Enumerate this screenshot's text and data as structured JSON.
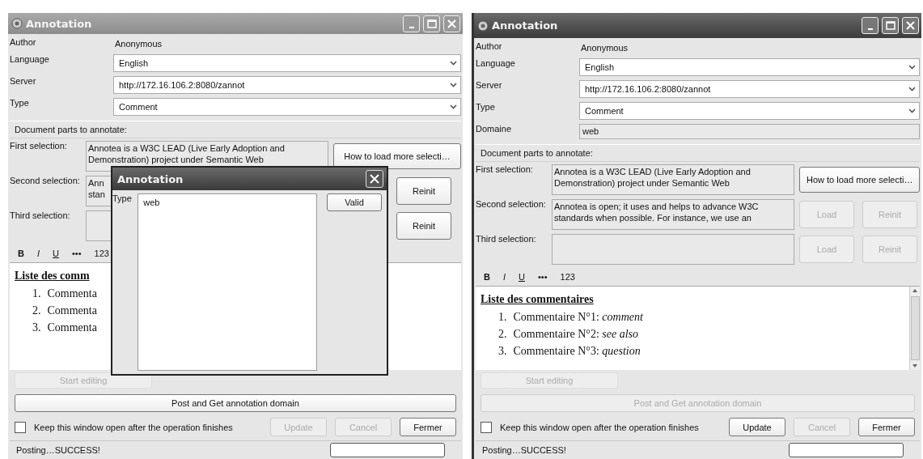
{
  "windows": [
    {
      "title": "Annotation",
      "active": false,
      "fields": [
        {
          "kind": "text",
          "label": "Author",
          "value": "Anonymous"
        },
        {
          "kind": "dropdown",
          "label": "Language",
          "value": "English"
        },
        {
          "kind": "dropdown",
          "label": "Server",
          "value": "http://172.16.106.2:8080/zannot"
        },
        {
          "kind": "dropdown",
          "label": "Type",
          "value": "Comment"
        }
      ],
      "section": "Document parts to annotate:",
      "selections": [
        {
          "label": "First selection:",
          "lines": [
            "Annotea is a W3C LEAD (Live Early Adoption and",
            "Demonstration) project under Semantic Web"
          ],
          "buttons": [
            {
              "kind": "wide",
              "label": "How to load more selecti…",
              "disabled": false
            }
          ]
        },
        {
          "label": "Second selection:",
          "lines": [
            "Ann",
            "stan"
          ],
          "buttons": [
            {
              "kind": "hidden"
            },
            {
              "kind": "normal",
              "label": "Reinit",
              "disabled": false
            }
          ]
        },
        {
          "label": "Third selection:",
          "buttons": [
            {
              "kind": "hidden"
            },
            {
              "kind": "normal",
              "label": "Reinit",
              "disabled": false
            }
          ]
        }
      ],
      "toolbar": [
        {
          "kind": "bold",
          "label": "B"
        },
        {
          "kind": "italic",
          "label": "I"
        },
        {
          "kind": "underline",
          "label": "U"
        },
        {
          "kind": "plain",
          "label": "•••"
        },
        {
          "kind": "plain",
          "label": "123"
        }
      ],
      "comments": {
        "heading": "Liste des comm",
        "items": [
          {
            "number": "1.",
            "text": "Commenta"
          },
          {
            "number": "2.",
            "text": "Commenta"
          },
          {
            "number": "3.",
            "text": "Commenta"
          }
        ],
        "scrollbar": false
      },
      "start_button": {
        "label": "Start editing",
        "disabled": true
      },
      "post_button": {
        "label": "Post and Get annotation domain",
        "disabled": false
      },
      "keep_open": {
        "label": "Keep this window open after the operation finishes",
        "checked": false
      },
      "buttons": [
        {
          "label": "Update",
          "disabled": true
        },
        {
          "label": "Cancel",
          "disabled": true
        },
        {
          "label": "Fermer",
          "disabled": false
        }
      ],
      "status": "Posting…SUCCESS!",
      "dialog": {
        "title": "Annotation",
        "label": "Type",
        "value": "web",
        "button": "Valid"
      }
    },
    {
      "title": "Annotation",
      "active": true,
      "fields": [
        {
          "kind": "text",
          "label": "Author",
          "value": "Anonymous"
        },
        {
          "kind": "dropdown",
          "label": "Language",
          "value": "English"
        },
        {
          "kind": "dropdown",
          "label": "Server",
          "value": "http://172.16.106.2:8080/zannot"
        },
        {
          "kind": "dropdown",
          "label": "Type",
          "value": "Comment"
        },
        {
          "kind": "readonly",
          "label": "Domaine",
          "value": "web"
        }
      ],
      "section": "Document parts to annotate:",
      "selections": [
        {
          "label": "First selection:",
          "lines": [
            "Annotea is a W3C LEAD (Live Early Adoption and",
            "Demonstration) project under Semantic Web"
          ],
          "buttons": [
            {
              "kind": "wide",
              "label": "How to load more selecti…",
              "disabled": false
            }
          ]
        },
        {
          "label": "Second selection:",
          "lines": [
            "Annotea is open; it uses and helps to advance W3C",
            "standards when possible. For instance, we use an"
          ],
          "buttons": [
            {
              "kind": "normal",
              "label": "Load",
              "disabled": true
            },
            {
              "kind": "normal",
              "label": "Reinit",
              "disabled": true
            }
          ]
        },
        {
          "label": "Third selection:",
          "buttons": [
            {
              "kind": "normal",
              "label": "Load",
              "disabled": true
            },
            {
              "kind": "normal",
              "label": "Reinit",
              "disabled": true
            }
          ]
        }
      ],
      "toolbar": [
        {
          "kind": "bold",
          "label": "B"
        },
        {
          "kind": "italic",
          "label": "I"
        },
        {
          "kind": "underline",
          "label": "U"
        },
        {
          "kind": "plain",
          "label": "•••"
        },
        {
          "kind": "plain",
          "label": "123"
        }
      ],
      "comments": {
        "heading": "Liste des commentaires",
        "items": [
          {
            "number": "1.",
            "text": "Commentaire N°1: *comment*"
          },
          {
            "number": "2.",
            "text": "Commentaire N°2: *see also*"
          },
          {
            "number": "3.",
            "text": "Commentaire N°3: *question*"
          }
        ],
        "scrollbar": true
      },
      "start_button": {
        "label": "Start editing",
        "disabled": true
      },
      "post_button": {
        "label": "Post and Get annotation domain",
        "disabled": true
      },
      "keep_open": {
        "label": "Keep this window open after the operation finishes",
        "checked": false
      },
      "buttons": [
        {
          "label": "Update",
          "disabled": false
        },
        {
          "label": "Cancel",
          "disabled": true
        },
        {
          "label": "Fermer",
          "disabled": false
        }
      ],
      "status": "Posting…SUCCESS!"
    }
  ]
}
